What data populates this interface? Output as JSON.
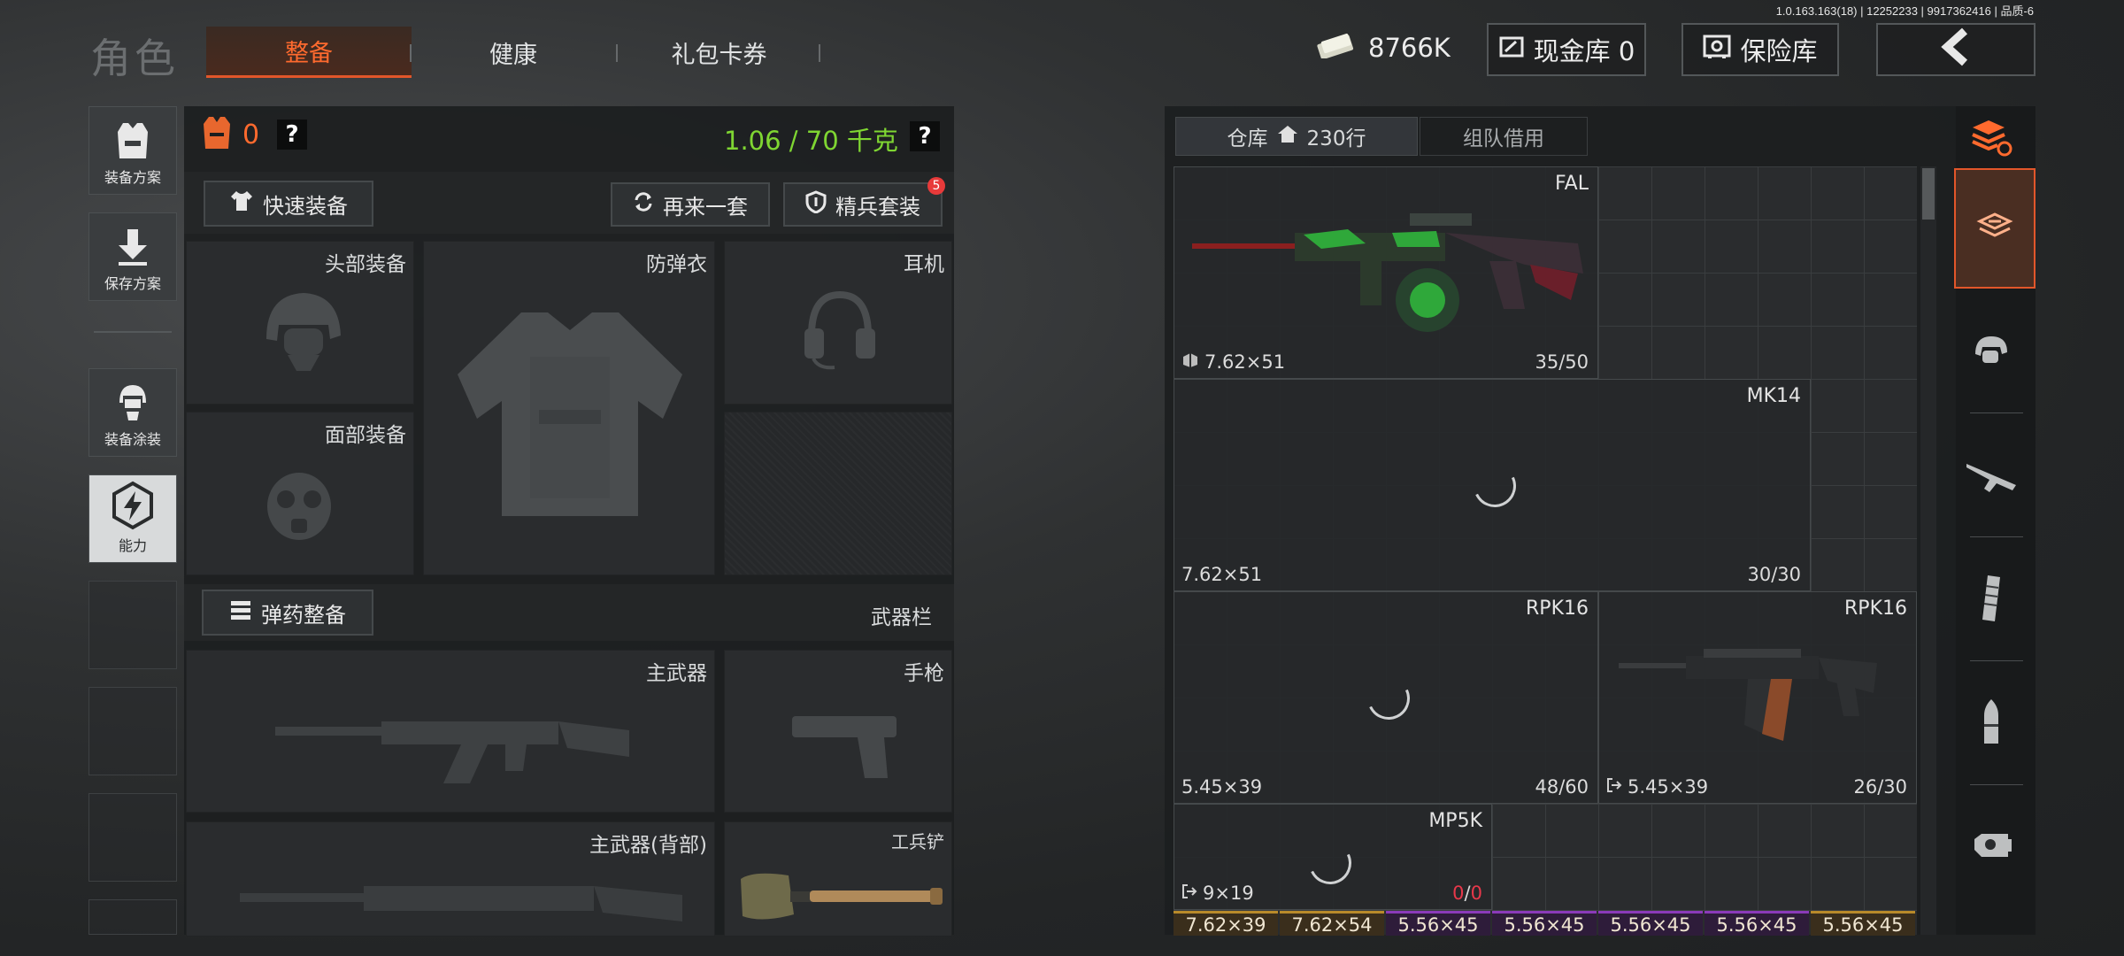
{
  "version_info": "1.0.163.163(18) | 12252233 | 9917362416 | 品质-6",
  "nav": {
    "title": "角色",
    "tabs": [
      {
        "label": "整备",
        "active": true
      },
      {
        "label": "健康",
        "active": false
      },
      {
        "label": "礼包卡券",
        "active": false
      }
    ]
  },
  "hud": {
    "cash": "8766K",
    "cash_vault": "现金库 0",
    "safe_vault": "保险库"
  },
  "left_rail": {
    "items": [
      {
        "label": "装备方案",
        "icon": "vest-icon"
      },
      {
        "label": "保存方案",
        "icon": "download-arrow-icon"
      },
      {
        "label": "装备涂装",
        "icon": "helmet-paint-icon"
      },
      {
        "label": "能力",
        "icon": "lightning-badge-icon",
        "active": true
      }
    ]
  },
  "loadout": {
    "armor_count": "0",
    "weight": "1.06 / 70 千克",
    "quick_equip": "快速装备",
    "reroll": "再来一套",
    "elite_kit": "精兵套装",
    "elite_badge": "5",
    "slots": {
      "head": "头部装备",
      "armor": "防弹衣",
      "headset": "耳机",
      "face": "面部装备"
    },
    "ammo_prep": "弹药整备",
    "weapon_bar": "武器栏",
    "weapons": {
      "primary": "主武器",
      "pistol": "手枪",
      "primary_back": "主武器(背部)",
      "shovel": "工兵铲"
    }
  },
  "inventory": {
    "tab_warehouse": "仓库",
    "rows": "230行",
    "tab_team": "组队借用",
    "items": [
      {
        "name": "FAL",
        "caliber": "7.62×51",
        "ammo": "35/50",
        "has_image": true
      },
      {
        "name": "MK14",
        "caliber": "7.62×51",
        "ammo": "30/30"
      },
      {
        "name": "RPK16",
        "caliber": "5.45×39",
        "ammo": "48/60"
      },
      {
        "name": "RPK16",
        "caliber": "5.45×39",
        "ammo": "26/30",
        "has_image": true
      },
      {
        "name": "MP5K",
        "caliber": "9×19",
        "ammo_current": "0",
        "ammo_sep": "/",
        "ammo_max": "0"
      }
    ],
    "ammo_chips": [
      {
        "label": "7.62×39",
        "color": "#b88a2a"
      },
      {
        "label": "7.62×54",
        "color": "#b88a2a"
      },
      {
        "label": "5.56×45",
        "color": "#8a3ab8"
      },
      {
        "label": "5.56×45",
        "color": "#8a3ab8"
      },
      {
        "label": "5.56×45",
        "color": "#8a3ab8"
      },
      {
        "label": "5.56×45",
        "color": "#8a3ab8"
      },
      {
        "label": "5.56×45",
        "color": "#b88a2a"
      }
    ]
  },
  "side_filters": [
    "all-items-icon",
    "helmet-icon",
    "rifle-icon",
    "magazine-icon",
    "bullet-icon",
    "scope-icon"
  ],
  "colors": {
    "accent": "#ff6a2e",
    "weight_green": "#7fd632",
    "badge_red": "#e83a3a",
    "ammo_empty": "#e8384a"
  }
}
